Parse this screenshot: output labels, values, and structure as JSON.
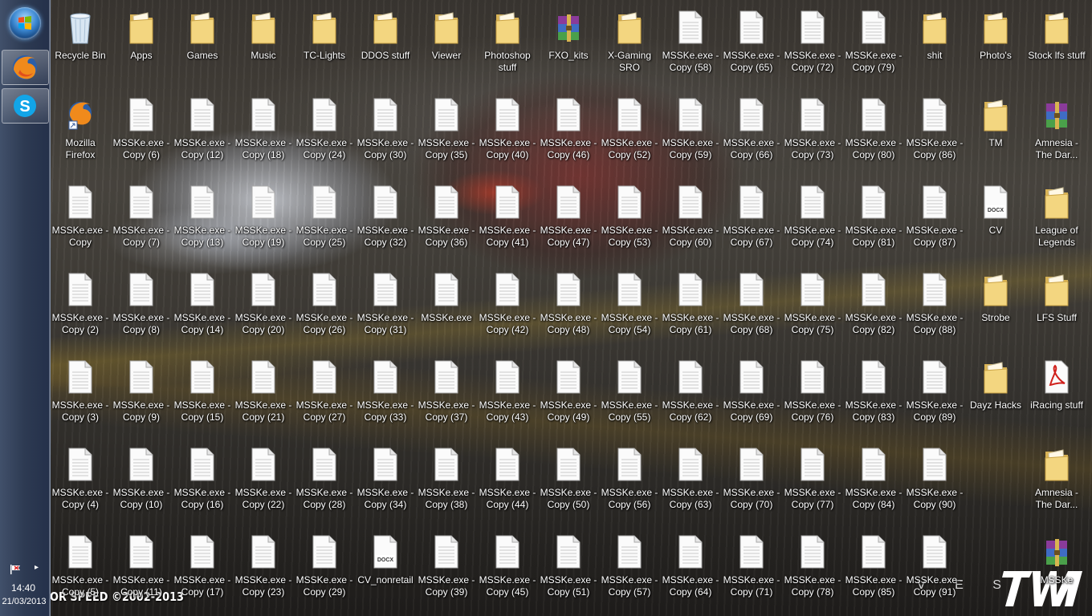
{
  "taskbar": {
    "pinned": [
      {
        "name": "firefox-taskbar-button",
        "icon": "firefox-icon"
      },
      {
        "name": "skype-taskbar-button",
        "icon": "skype-icon"
      }
    ],
    "clock": {
      "time": "14:40",
      "date": "21/03/2013"
    }
  },
  "wallpaper": {
    "banner": "OR SPEED ©2002-2013",
    "watermark": "V E S",
    "logo": "TW"
  },
  "desktop_icons": [
    {
      "label": "Recycle Bin",
      "type": "recycle"
    },
    {
      "label": "Apps",
      "type": "folder"
    },
    {
      "label": "Games",
      "type": "folder"
    },
    {
      "label": "Music",
      "type": "folder"
    },
    {
      "label": "TC-Lights",
      "type": "folder"
    },
    {
      "label": "DDOS stuff",
      "type": "folder"
    },
    {
      "label": "Viewer",
      "type": "folder"
    },
    {
      "label": "Photoshop stuff",
      "type": "folder"
    },
    {
      "label": "FXO_kits",
      "type": "rar"
    },
    {
      "label": "X-Gaming SRO",
      "type": "folder"
    },
    {
      "label": "MSSKe.exe - Copy (58)",
      "type": "doc"
    },
    {
      "label": "MSSKe.exe - Copy (65)",
      "type": "doc"
    },
    {
      "label": "MSSKe.exe - Copy (72)",
      "type": "doc"
    },
    {
      "label": "MSSKe.exe - Copy (79)",
      "type": "doc"
    },
    {
      "label": "shit",
      "type": "folder"
    },
    {
      "label": "Photo's",
      "type": "folder"
    },
    {
      "label": "Stock lfs stuff",
      "type": "folder"
    },
    {
      "label": "Mozilla Firefox",
      "type": "firefox"
    },
    {
      "label": "MSSKe.exe - Copy (6)",
      "type": "doc"
    },
    {
      "label": "MSSKe.exe - Copy (12)",
      "type": "doc"
    },
    {
      "label": "MSSKe.exe - Copy (18)",
      "type": "doc"
    },
    {
      "label": "MSSKe.exe - Copy (24)",
      "type": "doc"
    },
    {
      "label": "MSSKe.exe - Copy (30)",
      "type": "doc"
    },
    {
      "label": "MSSKe.exe - Copy (35)",
      "type": "doc"
    },
    {
      "label": "MSSKe.exe - Copy (40)",
      "type": "doc"
    },
    {
      "label": "MSSKe.exe - Copy (46)",
      "type": "doc"
    },
    {
      "label": "MSSKe.exe - Copy (52)",
      "type": "doc"
    },
    {
      "label": "MSSKe.exe - Copy (59)",
      "type": "doc"
    },
    {
      "label": "MSSKe.exe - Copy (66)",
      "type": "doc"
    },
    {
      "label": "MSSKe.exe - Copy (73)",
      "type": "doc"
    },
    {
      "label": "MSSKe.exe - Copy (80)",
      "type": "doc"
    },
    {
      "label": "MSSKe.exe - Copy (86)",
      "type": "doc"
    },
    {
      "label": "TM",
      "type": "folder"
    },
    {
      "label": "Amnesia - The Dar...",
      "type": "rar"
    },
    {
      "label": "MSSKe.exe - Copy",
      "type": "doc"
    },
    {
      "label": "MSSKe.exe - Copy (7)",
      "type": "doc"
    },
    {
      "label": "MSSKe.exe - Copy (13)",
      "type": "doc"
    },
    {
      "label": "MSSKe.exe - Copy (19)",
      "type": "doc"
    },
    {
      "label": "MSSKe.exe - Copy (25)",
      "type": "doc"
    },
    {
      "label": "MSSKe.exe - Copy (32)",
      "type": "doc"
    },
    {
      "label": "MSSKe.exe - Copy (36)",
      "type": "doc"
    },
    {
      "label": "MSSKe.exe - Copy (41)",
      "type": "doc"
    },
    {
      "label": "MSSKe.exe - Copy (47)",
      "type": "doc"
    },
    {
      "label": "MSSKe.exe - Copy (53)",
      "type": "doc"
    },
    {
      "label": "MSSKe.exe - Copy (60)",
      "type": "doc"
    },
    {
      "label": "MSSKe.exe - Copy (67)",
      "type": "doc"
    },
    {
      "label": "MSSKe.exe - Copy (74)",
      "type": "doc"
    },
    {
      "label": "MSSKe.exe - Copy (81)",
      "type": "doc"
    },
    {
      "label": "MSSKe.exe - Copy (87)",
      "type": "doc"
    },
    {
      "label": "CV",
      "type": "docx"
    },
    {
      "label": "League of Legends",
      "type": "folder"
    },
    {
      "label": "MSSKe.exe - Copy (2)",
      "type": "doc"
    },
    {
      "label": "MSSKe.exe - Copy (8)",
      "type": "doc"
    },
    {
      "label": "MSSKe.exe - Copy (14)",
      "type": "doc"
    },
    {
      "label": "MSSKe.exe - Copy (20)",
      "type": "doc"
    },
    {
      "label": "MSSKe.exe - Copy (26)",
      "type": "doc"
    },
    {
      "label": "MSSKe.exe - Copy (31)",
      "type": "doc"
    },
    {
      "label": "MSSKe.exe",
      "type": "doc"
    },
    {
      "label": "MSSKe.exe - Copy (42)",
      "type": "doc"
    },
    {
      "label": "MSSKe.exe - Copy (48)",
      "type": "doc"
    },
    {
      "label": "MSSKe.exe - Copy (54)",
      "type": "doc"
    },
    {
      "label": "MSSKe.exe - Copy (61)",
      "type": "doc"
    },
    {
      "label": "MSSKe.exe - Copy (68)",
      "type": "doc"
    },
    {
      "label": "MSSKe.exe - Copy (75)",
      "type": "doc"
    },
    {
      "label": "MSSKe.exe - Copy (82)",
      "type": "doc"
    },
    {
      "label": "MSSKe.exe - Copy (88)",
      "type": "doc"
    },
    {
      "label": "Strobe",
      "type": "folder"
    },
    {
      "label": "LFS Stuff",
      "type": "folder"
    },
    {
      "label": "MSSKe.exe - Copy (3)",
      "type": "doc"
    },
    {
      "label": "MSSKe.exe - Copy (9)",
      "type": "doc"
    },
    {
      "label": "MSSKe.exe - Copy (15)",
      "type": "doc"
    },
    {
      "label": "MSSKe.exe - Copy (21)",
      "type": "doc"
    },
    {
      "label": "MSSKe.exe - Copy (27)",
      "type": "doc"
    },
    {
      "label": "MSSKe.exe - Copy (33)",
      "type": "doc"
    },
    {
      "label": "MSSKe.exe - Copy (37)",
      "type": "doc"
    },
    {
      "label": "MSSKe.exe - Copy (43)",
      "type": "doc"
    },
    {
      "label": "MSSKe.exe - Copy (49)",
      "type": "doc"
    },
    {
      "label": "MSSKe.exe - Copy (55)",
      "type": "doc"
    },
    {
      "label": "MSSKe.exe - Copy (62)",
      "type": "doc"
    },
    {
      "label": "MSSKe.exe - Copy (69)",
      "type": "doc"
    },
    {
      "label": "MSSKe.exe - Copy (76)",
      "type": "doc"
    },
    {
      "label": "MSSKe.exe - Copy (83)",
      "type": "doc"
    },
    {
      "label": "MSSKe.exe - Copy (89)",
      "type": "doc"
    },
    {
      "label": "Dayz Hacks",
      "type": "folder"
    },
    {
      "label": "iRacing stuff",
      "type": "pdf"
    },
    {
      "label": "MSSKe.exe - Copy (4)",
      "type": "doc"
    },
    {
      "label": "MSSKe.exe - Copy (10)",
      "type": "doc"
    },
    {
      "label": "MSSKe.exe - Copy (16)",
      "type": "doc"
    },
    {
      "label": "MSSKe.exe - Copy (22)",
      "type": "doc"
    },
    {
      "label": "MSSKe.exe - Copy (28)",
      "type": "doc"
    },
    {
      "label": "MSSKe.exe - Copy (34)",
      "type": "doc"
    },
    {
      "label": "MSSKe.exe - Copy (38)",
      "type": "doc"
    },
    {
      "label": "MSSKe.exe - Copy (44)",
      "type": "doc"
    },
    {
      "label": "MSSKe.exe - Copy (50)",
      "type": "doc"
    },
    {
      "label": "MSSKe.exe - Copy (56)",
      "type": "doc"
    },
    {
      "label": "MSSKe.exe - Copy (63)",
      "type": "doc"
    },
    {
      "label": "MSSKe.exe - Copy (70)",
      "type": "doc"
    },
    {
      "label": "MSSKe.exe - Copy (77)",
      "type": "doc"
    },
    {
      "label": "MSSKe.exe - Copy (84)",
      "type": "doc"
    },
    {
      "label": "MSSKe.exe - Copy (90)",
      "type": "doc"
    },
    null,
    {
      "label": "Amnesia - The Dar...",
      "type": "folder"
    },
    {
      "label": "MSSKe.exe - Copy (5)",
      "type": "doc"
    },
    {
      "label": "MSSKe.exe - Copy (11)",
      "type": "doc"
    },
    {
      "label": "MSSKe.exe - Copy (17)",
      "type": "doc"
    },
    {
      "label": "MSSKe.exe - Copy (23)",
      "type": "doc"
    },
    {
      "label": "MSSKe.exe - Copy (29)",
      "type": "doc"
    },
    {
      "label": "CV_nonretail",
      "type": "docx"
    },
    {
      "label": "MSSKe.exe - Copy (39)",
      "type": "doc"
    },
    {
      "label": "MSSKe.exe - Copy (45)",
      "type": "doc"
    },
    {
      "label": "MSSKe.exe - Copy (51)",
      "type": "doc"
    },
    {
      "label": "MSSKe.exe - Copy (57)",
      "type": "doc"
    },
    {
      "label": "MSSKe.exe - Copy (64)",
      "type": "doc"
    },
    {
      "label": "MSSKe.exe - Copy (71)",
      "type": "doc"
    },
    {
      "label": "MSSKe.exe - Copy (78)",
      "type": "doc"
    },
    {
      "label": "MSSKe.exe - Copy (85)",
      "type": "doc"
    },
    {
      "label": "MSSKe.exe - Copy (91)",
      "type": "doc"
    },
    null,
    {
      "label": "MSSKe",
      "type": "rar"
    }
  ]
}
